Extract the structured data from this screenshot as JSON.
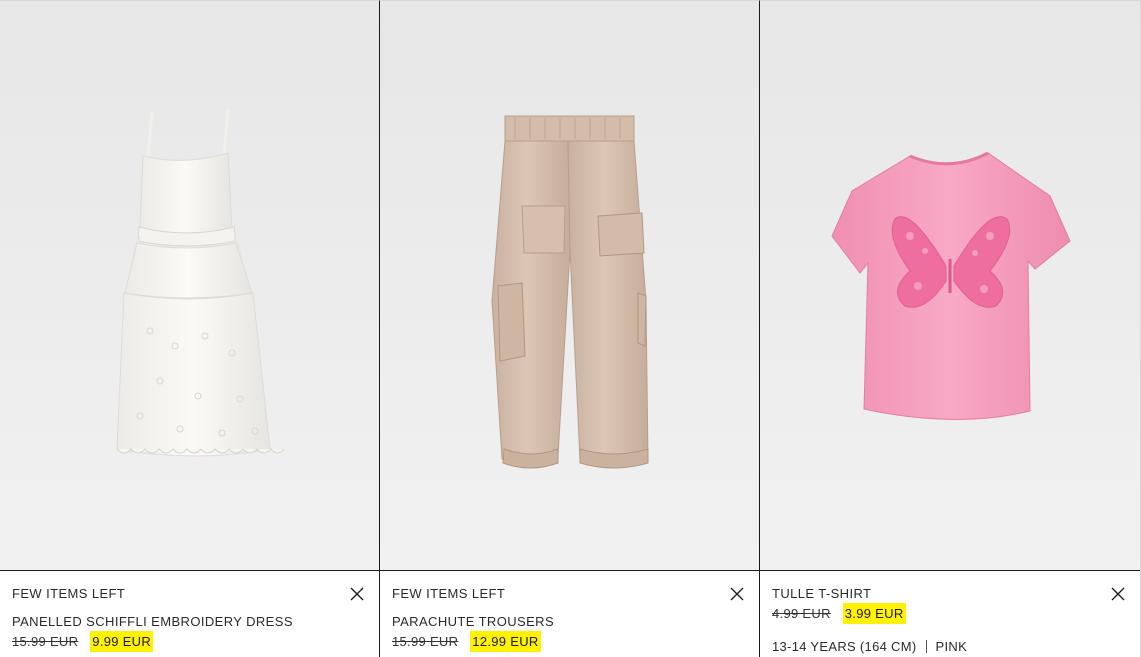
{
  "products": [
    {
      "badge": "FEW ITEMS LEFT",
      "name": "PANELLED SCHIFFLI EMBROIDERY DRESS",
      "old_price": "15.99 EUR",
      "new_price": "9.99 EUR",
      "image": "white-dress",
      "close_icon": "close-icon"
    },
    {
      "badge": "FEW ITEMS LEFT",
      "name": "PARACHUTE TROUSERS",
      "old_price": "15.99 EUR",
      "new_price": "12.99 EUR",
      "image": "beige-cargo-trousers",
      "close_icon": "close-icon"
    },
    {
      "name": "TULLE T-SHIRT",
      "old_price": "4.99 EUR",
      "new_price": "3.99 EUR",
      "size": "13-14 YEARS (164 CM)",
      "color": "PINK",
      "image": "pink-butterfly-tshirt",
      "close_icon": "close-icon"
    }
  ],
  "colors": {
    "sale_highlight": "#fff200",
    "image_background": "#ececec",
    "dress": "#f7f6f2",
    "trousers": "#d6bfae",
    "tshirt": "#f59fbd",
    "butterfly": "#ef7aa6"
  }
}
